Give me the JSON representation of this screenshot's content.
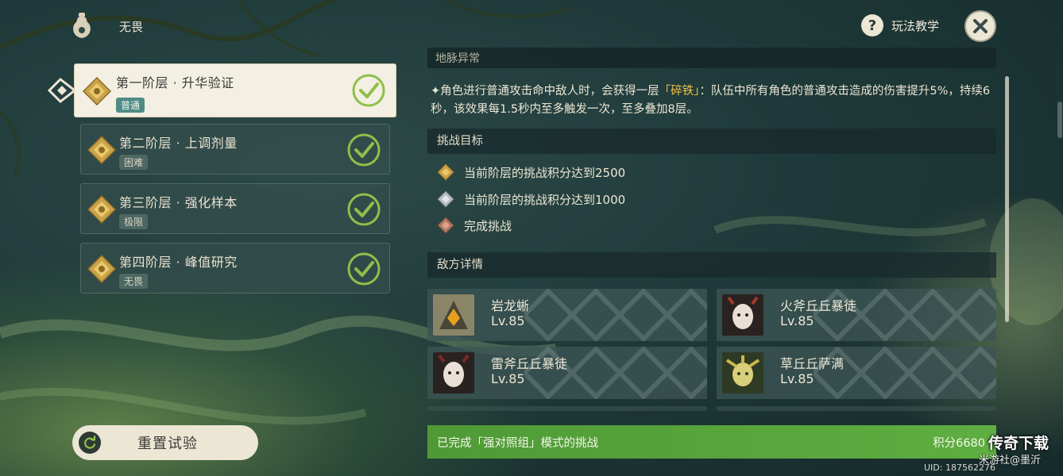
{
  "header": {
    "title": "无畏",
    "help_label": "玩法教学"
  },
  "tiers": [
    {
      "name": "第一阶层 · 升华验证",
      "difficulty": "普通",
      "completed": true,
      "selected": true
    },
    {
      "name": "第二阶层 · 上调剂量",
      "difficulty": "困难",
      "completed": true,
      "selected": false
    },
    {
      "name": "第三阶层 · 强化样本",
      "difficulty": "极限",
      "completed": true,
      "selected": false
    },
    {
      "name": "第四阶层 · 峰值研究",
      "difficulty": "无畏",
      "completed": true,
      "selected": false
    }
  ],
  "reset_button": {
    "label": "重置试验"
  },
  "panel": {
    "partial_heading": "地脉异常",
    "description": {
      "bullet": "✦",
      "before": "角色进行普通攻击命中敌人时，会获得一层",
      "highlight": "「碎铁」",
      "after": "：队伍中所有角色的普通攻击造成的伤害提升5%，持续6秒，该效果每1.5秒内至多触发一次，至多叠加8层。"
    },
    "goals_heading": "挑战目标",
    "goals": [
      {
        "text": "当前阶层的挑战积分达到2500",
        "tier": "gold"
      },
      {
        "text": "当前阶层的挑战积分达到1000",
        "tier": "silver"
      },
      {
        "text": "完成挑战",
        "tier": "bronze"
      }
    ],
    "enemies_heading": "敌方详情",
    "enemies": [
      {
        "name": "岩龙蜥",
        "level": "Lv.85"
      },
      {
        "name": "火斧丘丘暴徒",
        "level": "Lv.85"
      },
      {
        "name": "雷斧丘丘暴徒",
        "level": "Lv.85"
      },
      {
        "name": "草丘丘萨满",
        "level": "Lv.85"
      }
    ]
  },
  "completion": {
    "message": "已完成「强对照组」模式的挑战",
    "score": "积分6680"
  },
  "watermark": {
    "main": "传奇下载",
    "sub": "米游社@墨沂"
  },
  "uid": "UID: 187562276",
  "colors": {
    "accent_green": "#5aa83d",
    "highlight_gold": "#f0c245",
    "check_green": "#8fbf4a"
  }
}
